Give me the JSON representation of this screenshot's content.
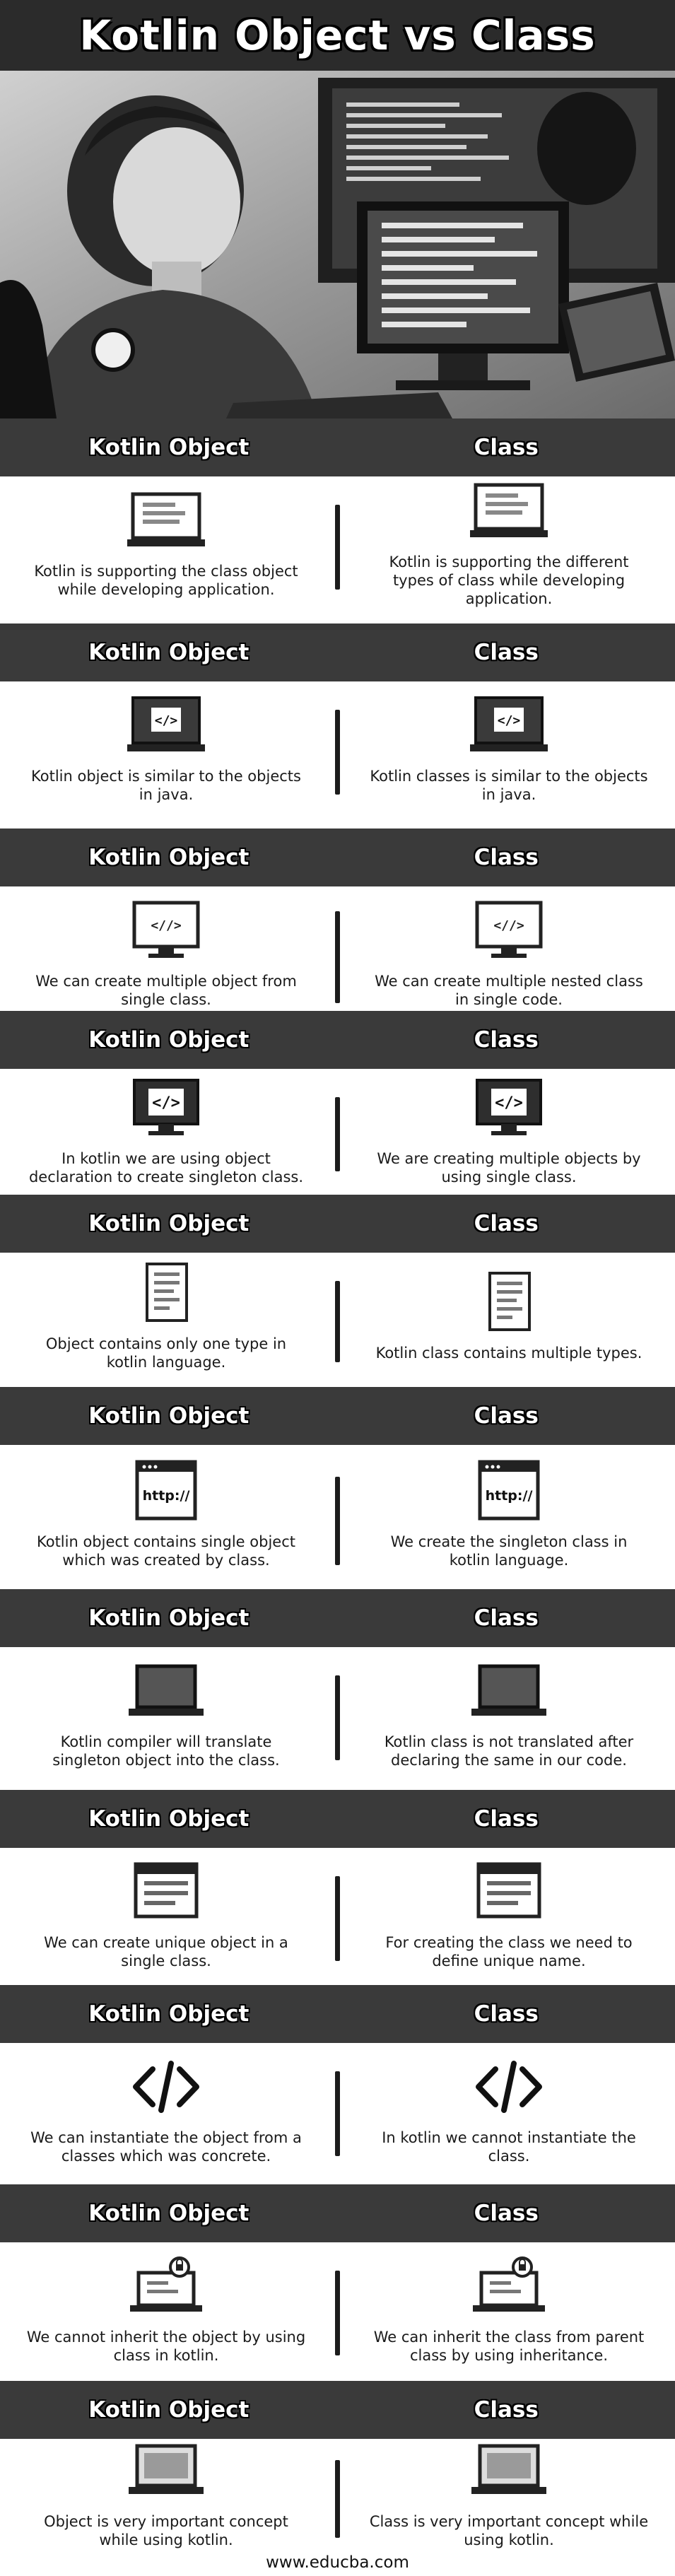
{
  "title": "Kotlin Object vs Class",
  "header_left": "Kotlin Object",
  "header_right": "Class",
  "footer": "www.educba.com",
  "rows": [
    {
      "left": {
        "text": "Kotlin is supporting the class object while developing application.",
        "icon": "document-laptop-icon"
      },
      "right": {
        "text": "Kotlin is supporting the different types of class while developing application.",
        "icon": "document-laptop-icon"
      }
    },
    {
      "left": {
        "text": "Kotlin object is similar to the objects in java.",
        "icon": "code-laptop-icon"
      },
      "right": {
        "text": "Kotlin classes is similar to the objects in java.",
        "icon": "code-laptop-icon"
      }
    },
    {
      "left": {
        "text": "We can create multiple object from single class.",
        "icon": "code-monitor-icon"
      },
      "right": {
        "text": "We can create multiple nested class in single code.",
        "icon": "code-monitor-icon"
      }
    },
    {
      "left": {
        "text": "In kotlin we are using object declaration to create singleton class.",
        "icon": "code-monitor-icon"
      },
      "right": {
        "text": "We are creating multiple objects by using single class.",
        "icon": "code-monitor-icon"
      }
    },
    {
      "left": {
        "text": "Object contains only one type in kotlin language.",
        "icon": "document-icon"
      },
      "right": {
        "text": "Kotlin class contains multiple types.",
        "icon": "document-icon"
      }
    },
    {
      "left": {
        "text": "Kotlin object contains single object which was created by class.",
        "icon": "http-window-icon"
      },
      "right": {
        "text": "We create the singleton class in kotlin language.",
        "icon": "http-window-icon"
      }
    },
    {
      "left": {
        "text": "Kotlin compiler will translate singleton object into the class.",
        "icon": "laptop-icon"
      },
      "right": {
        "text": "Kotlin class is not translated after declaring the same in our code.",
        "icon": "laptop-icon"
      }
    },
    {
      "left": {
        "text": "We can create unique object in a single class.",
        "icon": "browser-window-icon"
      },
      "right": {
        "text": "For creating the class we need to define unique name.",
        "icon": "browser-window-icon"
      }
    },
    {
      "left": {
        "text": "We can instantiate the object from a classes which was concrete.",
        "icon": "code-brackets-icon"
      },
      "right": {
        "text": "In kotlin we cannot instantiate the class.",
        "icon": "code-brackets-icon"
      }
    },
    {
      "left": {
        "text": "We cannot inherit the object by using class in kotlin.",
        "icon": "locked-laptop-icon"
      },
      "right": {
        "text": "We can inherit the class from parent class by using inheritance.",
        "icon": "locked-laptop-icon"
      }
    },
    {
      "left": {
        "text": "Object is very important concept while using kotlin.",
        "icon": "laptop-screen-icon"
      },
      "right": {
        "text": "Class is very important concept while using kotlin.",
        "icon": "laptop-screen-icon"
      }
    }
  ]
}
